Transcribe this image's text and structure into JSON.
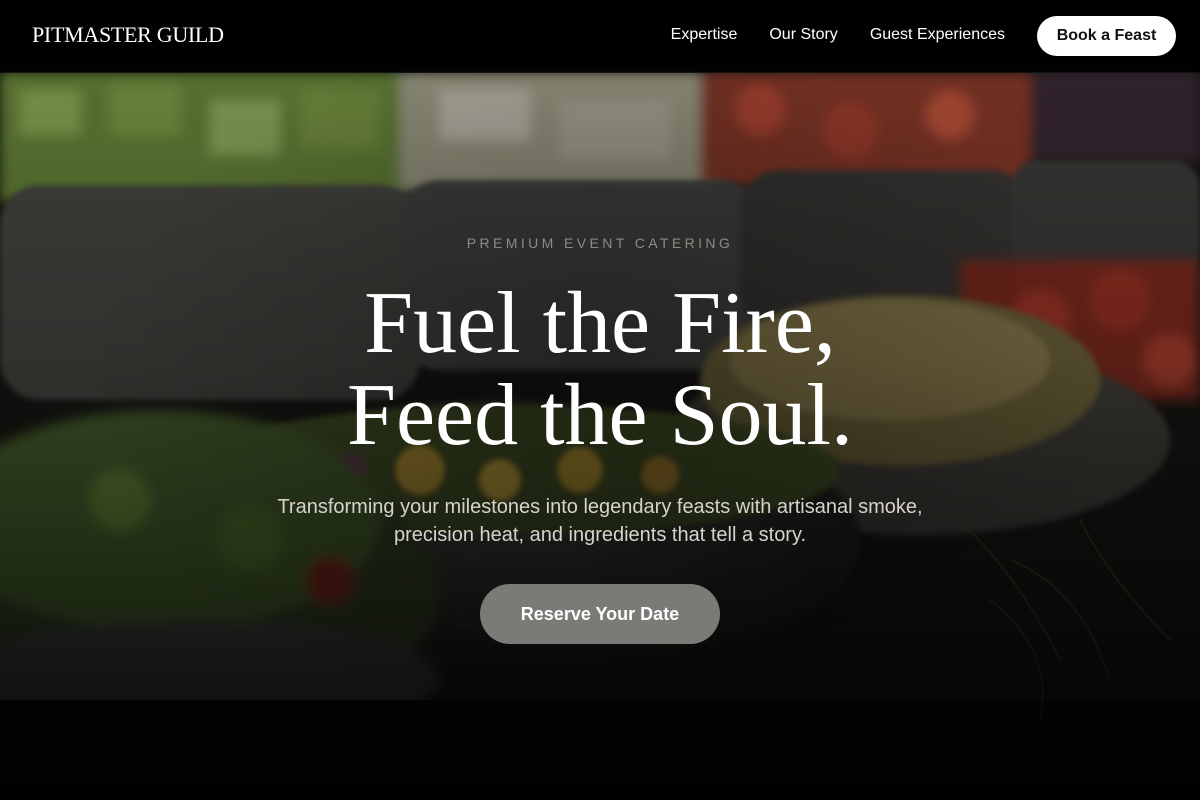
{
  "brand": {
    "name": "PITMASTER GUILD"
  },
  "nav": {
    "links": [
      {
        "label": "Expertise"
      },
      {
        "label": "Our Story"
      },
      {
        "label": "Guest Experiences"
      }
    ],
    "cta_label": "Book a Feast"
  },
  "hero": {
    "eyebrow": "PREMIUM EVENT CATERING",
    "headline_line1": "Fuel the Fire,",
    "headline_line2": "Feed the Soul.",
    "subtitle": "Transforming your milestones into legendary feasts with artisanal smoke, precision heat, and ingredients that tell a story.",
    "cta_label": "Reserve Your Date",
    "background_image": "salad-bowls-photo"
  },
  "colors": {
    "nav_bg": "#000000",
    "cta_nav_bg": "#ffffff",
    "cta_main_bg": "#7b7a77",
    "eyebrow_text": "#8c8a86",
    "subtitle_text": "#d6d3cc"
  }
}
